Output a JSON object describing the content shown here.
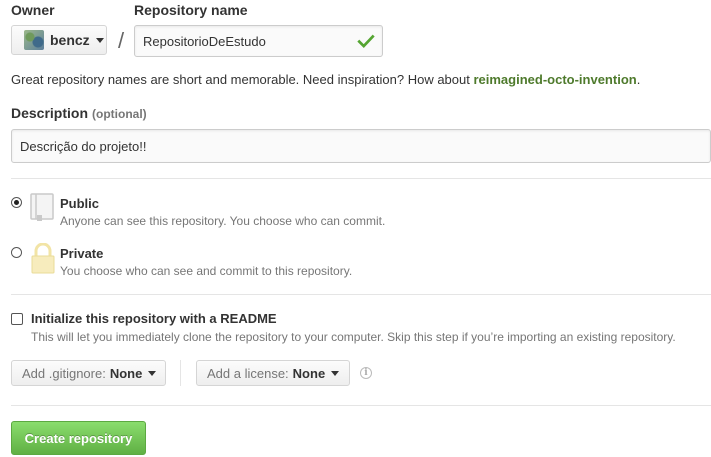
{
  "owner": {
    "label": "Owner",
    "selected": "bencz"
  },
  "repository": {
    "label": "Repository name",
    "separator": "/",
    "value": "RepositorioDeEstudo"
  },
  "hint": {
    "text": "Great repository names are short and memorable. Need inspiration? How about ",
    "suggestion": "reimagined-octo-invention",
    "end": "."
  },
  "description": {
    "label": "Description",
    "optional": "(optional)",
    "value": "Descrição do projeto!!"
  },
  "visibility": {
    "public": {
      "title": "Public",
      "subtitle": "Anyone can see this repository. You choose who can commit.",
      "checked": true
    },
    "private": {
      "title": "Private",
      "subtitle": "You choose who can see and commit to this repository.",
      "checked": false
    }
  },
  "readme": {
    "title": "Initialize this repository with a README",
    "subtitle": "This will let you immediately clone the repository to your computer. Skip this step if you’re importing an existing repository.",
    "checked": false
  },
  "gitignore": {
    "label": "Add .gitignore:",
    "value": "None"
  },
  "license": {
    "label": "Add a license:",
    "value": "None"
  },
  "info_icon_glyph": "i",
  "create_button": {
    "label": "Create repository"
  },
  "colors": {
    "accent_green": "#4e7a2c",
    "button_green": "#60b044",
    "check_green": "#55a532"
  }
}
